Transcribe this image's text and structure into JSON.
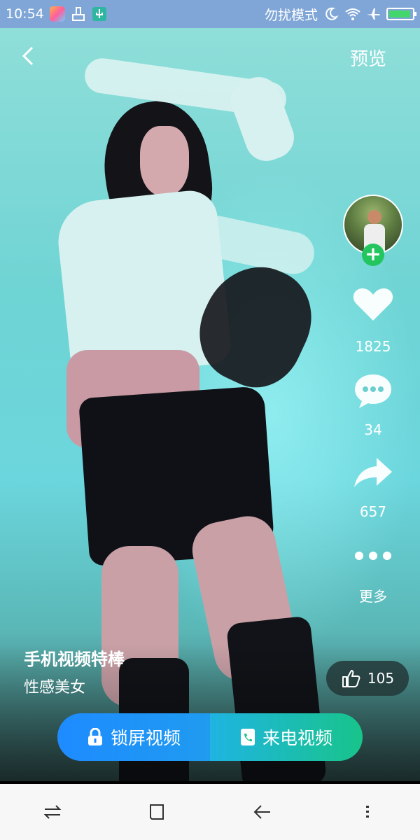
{
  "status_bar": {
    "time": "10:54",
    "dnd_text": "勿扰模式",
    "icons": [
      "app-badge-icon",
      "broom-icon",
      "usb-icon",
      "moon-icon",
      "wifi-icon",
      "airplane-icon",
      "battery-icon"
    ],
    "battery_color": "#43d66a"
  },
  "header": {
    "back_label": "‹",
    "preview_label": "预览"
  },
  "actions": {
    "likes": "1825",
    "comments": "34",
    "shares": "657",
    "more_label": "更多",
    "follow_label": "+"
  },
  "caption": {
    "title": "手机视频特棒",
    "tag": "性感美女"
  },
  "like_chip": {
    "count": "105"
  },
  "cta": {
    "lock_label": "锁屏视频",
    "call_label": "来电视频"
  },
  "colors": {
    "accent_blue": "#1e8bff",
    "accent_green": "#18c48a",
    "status_bar": "#7fa6d6"
  }
}
